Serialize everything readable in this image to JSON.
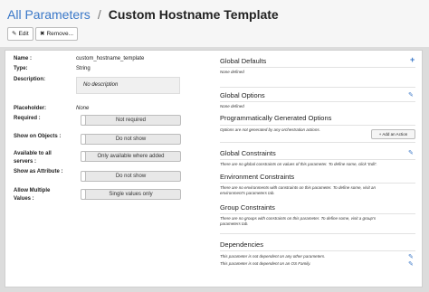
{
  "breadcrumb": {
    "parent": "All Parameters",
    "separator": "/",
    "current": "Custom Hostname Template"
  },
  "toolbar": {
    "edit_label": "Edit",
    "remove_label": "Remove..."
  },
  "fields": {
    "name_label": "Name :",
    "name_value": "custom_hostname_template",
    "type_label": "Type:",
    "type_value": "String",
    "description_label": "Description:",
    "description_value": "No description",
    "placeholder_label": "Placeholder:",
    "placeholder_value": "None",
    "required_label": "Required :",
    "required_value": "Not required",
    "show_on_objects_label": "Show on Objects :",
    "show_on_objects_value": "Do not show",
    "available_label_line1": "Available to all",
    "available_label_line2": "servers :",
    "available_value": "Only available where added",
    "show_as_attribute_label": "Show as Attribute :",
    "show_as_attribute_value": "Do not show",
    "allow_multiple_label_line1": "Allow Multiple",
    "allow_multiple_label_line2": "Values :",
    "allow_multiple_value": "Single values only"
  },
  "sections": {
    "global_defaults_title": "Global Defaults",
    "global_defaults_note": "None defined",
    "global_options_title": "Global Options",
    "global_options_note": "None defined",
    "prog_options_title": "Programmatically Generated Options",
    "prog_options_note": "Options are not generated by any orchestration actions.",
    "add_action_label": "Add an Action",
    "global_constraints_title": "Global Constraints",
    "global_constraints_note": "There are no global constraints on values of this parameter. To define some, click 'Edit'.",
    "env_constraints_title": "Environment Constraints",
    "env_constraints_note_line1": "There are no environments with constraints on this parameter. To define some, visit an",
    "env_constraints_note_line2": "environment's parameters tab.",
    "group_constraints_title": "Group Constraints",
    "group_constraints_note_line1": "There are no groups with constraints on this parameter. To define some, visit a group's",
    "group_constraints_note_line2": "parameters tab.",
    "dependencies_title": "Dependencies",
    "dependencies_note_line1": "This parameter is not dependent on any other parameters.",
    "dependencies_note_line2": "This parameter is not dependent on an OS Family."
  },
  "icons": {
    "edit": "pencil-icon",
    "remove": "close-icon",
    "add": "plus-icon"
  },
  "colors": {
    "link": "#3a78c8",
    "toggle_bg": "#e8e8e8"
  }
}
